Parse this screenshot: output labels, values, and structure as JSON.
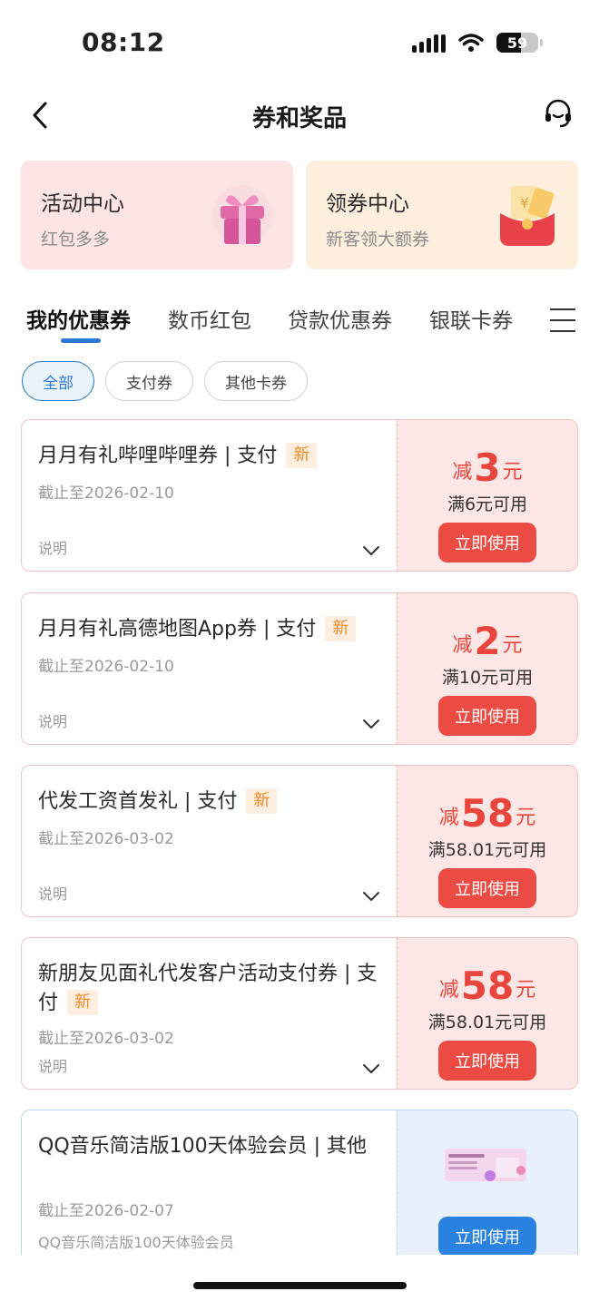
{
  "status": {
    "time": "08:12",
    "battery": "59"
  },
  "nav": {
    "title": "券和奖品"
  },
  "banners": [
    {
      "title": "活动中心",
      "subtitle": "红包多多"
    },
    {
      "title": "领券中心",
      "subtitle": "新客领大额券"
    }
  ],
  "tabs": [
    "我的优惠券",
    "数币红包",
    "贷款优惠券",
    "银联卡券"
  ],
  "chips": [
    "全部",
    "支付券",
    "其他卡券"
  ],
  "coupons": [
    {
      "title": "月月有礼哔哩哔哩券 | 支付",
      "tag": "新",
      "date": "截止至2026-02-10",
      "note": "说明",
      "prefix": "减",
      "amount": "3",
      "unit": "元",
      "condition": "满6元可用",
      "button": "立即使用"
    },
    {
      "title": "月月有礼高德地图App券 | 支付",
      "tag": "新",
      "date": "截止至2026-02-10",
      "note": "说明",
      "prefix": "减",
      "amount": "2",
      "unit": "元",
      "condition": "满10元可用",
      "button": "立即使用"
    },
    {
      "title": "代发工资首发礼 | 支付",
      "tag": "新",
      "date": "截止至2026-03-02",
      "note": "说明",
      "prefix": "减",
      "amount": "58",
      "unit": "元",
      "condition": "满58.01元可用",
      "button": "立即使用"
    },
    {
      "title": "新朋友见面礼代发客户活动支付券 | 支付",
      "tag": "新",
      "date": "截止至2026-03-02",
      "note": "说明",
      "prefix": "减",
      "amount": "58",
      "unit": "元",
      "condition": "满58.01元可用",
      "button": "立即使用"
    },
    {
      "title": "QQ音乐简洁版100天体验会员 | 其他",
      "date": "截止至2026-02-07",
      "note": "QQ音乐简洁版100天体验会员",
      "button": "立即使用"
    }
  ]
}
